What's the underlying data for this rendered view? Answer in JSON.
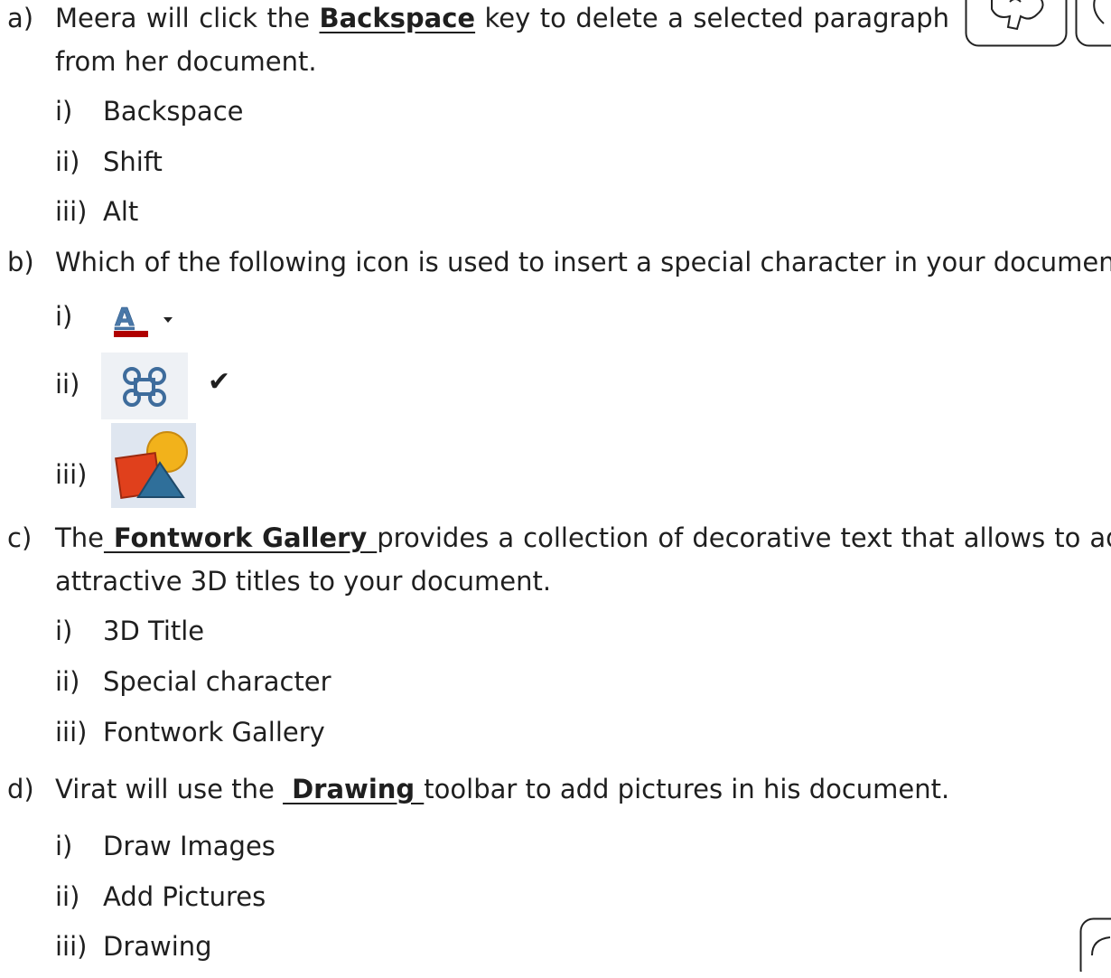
{
  "questions": [
    {
      "label": "a)",
      "line1_before": "Meera will click the ",
      "answer": "Backspace",
      "line1_after": " key to delete a selected paragraph",
      "line2": "from her document.",
      "options": [
        {
          "label": "i)",
          "text": "Backspace"
        },
        {
          "label": "ii)",
          "text": "Shift"
        },
        {
          "label": "iii)",
          "text": "Alt"
        }
      ]
    },
    {
      "label": "b)",
      "text": "Which of the following icon is used to insert a special character in your document?",
      "options": [
        {
          "label": "i)",
          "icon": "font-color-icon"
        },
        {
          "label": "ii)",
          "icon": "special-character-icon",
          "mark": "✔"
        },
        {
          "label": "iii)",
          "icon": "basic-shapes-icon"
        }
      ]
    },
    {
      "label": "c)",
      "line1_before": "The",
      "answer": " Fontwork Gallery ",
      "line1_after": "provides a collection of decorative text that allows to add",
      "line2": "attractive 3D titles to your document.",
      "options": [
        {
          "label": "i)",
          "text": "3D Title"
        },
        {
          "label": "ii)",
          "text": "Special character"
        },
        {
          "label": "iii)",
          "text": "Fontwork Gallery"
        }
      ]
    },
    {
      "label": "d)",
      "line1_before": "Virat will use the ",
      "answer": " Drawing ",
      "line1_after": "toolbar to add pictures in his document.",
      "options": [
        {
          "label": "i)",
          "text": "Draw Images"
        },
        {
          "label": "ii)",
          "text": "Add Pictures"
        },
        {
          "label": "iii)",
          "text": "Drawing"
        }
      ]
    }
  ],
  "colors": {
    "font_color_red": "#b00000",
    "glyph_blue": "#4a78a8",
    "shape_red": "#e0401c",
    "shape_yellow": "#f2b21b",
    "shape_teal": "#2f6f9a"
  }
}
